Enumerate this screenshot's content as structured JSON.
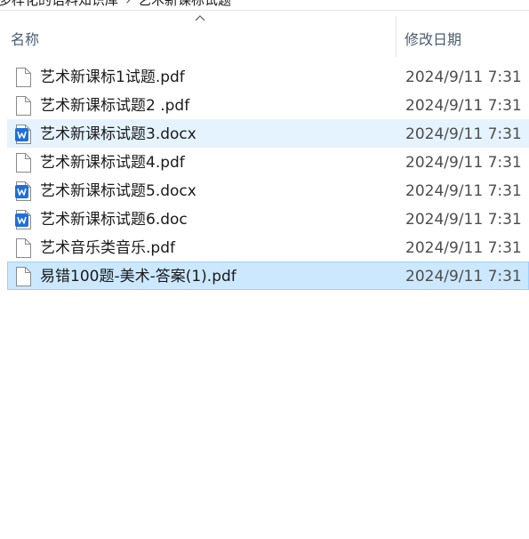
{
  "breadcrumb": {
    "items": [
      "多样化的语料知识库",
      "艺术新课标试题"
    ]
  },
  "columns": {
    "name": "名称",
    "date_modified": "修改日期"
  },
  "files": [
    {
      "name": "艺术新课标1试题.pdf",
      "date": "2024/9/11 7:31",
      "icon": "pdf-file-icon",
      "state": "normal"
    },
    {
      "name": "艺术新课标试题2 .pdf",
      "date": "2024/9/11 7:31",
      "icon": "pdf-file-icon",
      "state": "normal"
    },
    {
      "name": "艺术新课标试题3.docx",
      "date": "2024/9/11 7:31",
      "icon": "word-doc-icon",
      "state": "hover"
    },
    {
      "name": "艺术新课标试题4.pdf",
      "date": "2024/9/11 7:31",
      "icon": "pdf-file-icon",
      "state": "normal"
    },
    {
      "name": "艺术新课标试题5.docx",
      "date": "2024/9/11 7:31",
      "icon": "word-doc-icon",
      "state": "normal"
    },
    {
      "name": "艺术新课标试题6.doc",
      "date": "2024/9/11 7:31",
      "icon": "word-doc-icon",
      "state": "normal"
    },
    {
      "name": "艺术音乐类音乐.pdf",
      "date": "2024/9/11 7:31",
      "icon": "pdf-file-icon",
      "state": "normal"
    },
    {
      "name": "易错100题-美术-答案(1).pdf",
      "date": "2024/9/11 7:31",
      "icon": "pdf-file-icon",
      "state": "selected"
    }
  ],
  "colors": {
    "hover_bg": "#e5f3ff",
    "selected_bg": "#cce8ff",
    "selected_border": "#99d1ff",
    "word_blue": "#1e6fd9",
    "header_text": "#4b5d70"
  }
}
